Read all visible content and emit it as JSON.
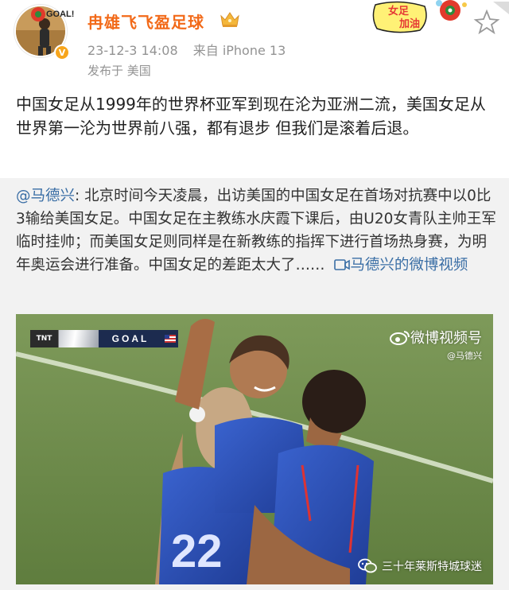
{
  "author": {
    "username": "冉雄飞飞盈足球",
    "avatar_tag": "GOAL!",
    "date": "23-12-3 14:08",
    "source": "来自 iPhone 13",
    "location": "发布于 美国"
  },
  "sticker": {
    "text_line1": "女足",
    "text_line2": "加油"
  },
  "post": {
    "text": "中国女足从1999年的世界杯亚军到现在沦为亚洲二流，美国女足从世界第一沦为世界前八强，都有退步 但我们是滚着后退。"
  },
  "repost": {
    "mention": "@马德兴",
    "body": ": 北京时间今天凌晨，出访美国的中国女足在首场对抗赛中以0比3输给美国女足。中国女足在主教练水庆霞下课后，由U20女青队主帅王军临时挂帅；而美国女足则同样是在新教练的指挥下进行首场热身赛，为明年奥运会进行准备。中国女足的差距太大了……",
    "video_link": "马德兴的微博视频"
  },
  "video": {
    "channel_tag": "TNT",
    "goal_label": "GOAL",
    "watermark_title": "微博视频号",
    "watermark_sub": "@马德兴",
    "jersey_number": "22"
  },
  "footer": {
    "account_watermark": "三十年莱斯特城球迷"
  },
  "colors": {
    "username": "#f26a19",
    "link": "#3a6ea5",
    "meta": "#939393",
    "repost_bg": "#f2f2f2",
    "jersey": "#2a4fb6"
  }
}
